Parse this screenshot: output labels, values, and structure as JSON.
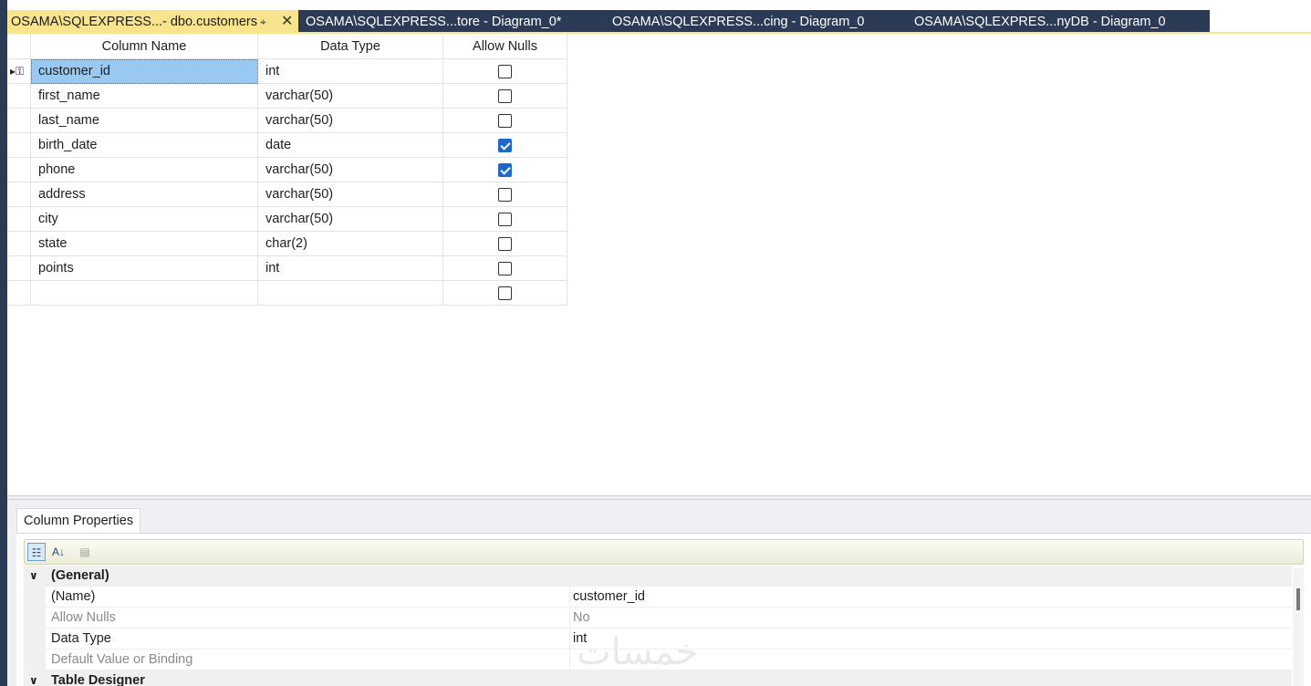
{
  "tabs": [
    {
      "label": "OSAMA\\SQLEXPRESS...- dbo.customers",
      "active": true
    },
    {
      "label": "OSAMA\\SQLEXPRESS...tore - Diagram_0*",
      "active": false
    },
    {
      "label": "OSAMA\\SQLEXPRESS...cing - Diagram_0",
      "active": false
    },
    {
      "label": "OSAMA\\SQLEXPRES...nyDB - Diagram_0",
      "active": false
    }
  ],
  "tab_icons": {
    "pin": "pin-icon",
    "close": "close-icon"
  },
  "grid": {
    "headers": {
      "name": "Column Name",
      "type": "Data Type",
      "nulls": "Allow Nulls"
    },
    "rows": [
      {
        "name": "customer_id",
        "type": "int",
        "allow_nulls": false
      },
      {
        "name": "first_name",
        "type": "varchar(50)",
        "allow_nulls": false
      },
      {
        "name": "last_name",
        "type": "varchar(50)",
        "allow_nulls": false
      },
      {
        "name": "birth_date",
        "type": "date",
        "allow_nulls": true
      },
      {
        "name": "phone",
        "type": "varchar(50)",
        "allow_nulls": true
      },
      {
        "name": "address",
        "type": "varchar(50)",
        "allow_nulls": false
      },
      {
        "name": "city",
        "type": "varchar(50)",
        "allow_nulls": false
      },
      {
        "name": "state",
        "type": "char(2)",
        "allow_nulls": false
      },
      {
        "name": "points",
        "type": "int",
        "allow_nulls": false
      },
      {
        "name": "",
        "type": "",
        "allow_nulls": false
      }
    ]
  },
  "properties": {
    "tab_label": "Column Properties",
    "toolbar_icons": [
      "categorized-icon",
      "alphabetical-icon",
      "property-pages-icon"
    ],
    "rows": [
      {
        "kind": "category",
        "name": "(General)"
      },
      {
        "kind": "prop",
        "name": "(Name)",
        "value": "customer_id",
        "dim": false
      },
      {
        "kind": "prop",
        "name": "Allow Nulls",
        "value": "No",
        "dim": true
      },
      {
        "kind": "prop",
        "name": "Data Type",
        "value": "int",
        "dim": false
      },
      {
        "kind": "prop",
        "name": "Default Value or Binding",
        "value": "",
        "dim": true
      },
      {
        "kind": "category",
        "name": "Table Designer"
      }
    ]
  },
  "watermark": "خمسات",
  "colors": {
    "frame": "#2b3a55",
    "active_tab": "#f7e48c",
    "selection": "#99c8f0",
    "checkbox_on": "#1d68c8"
  }
}
